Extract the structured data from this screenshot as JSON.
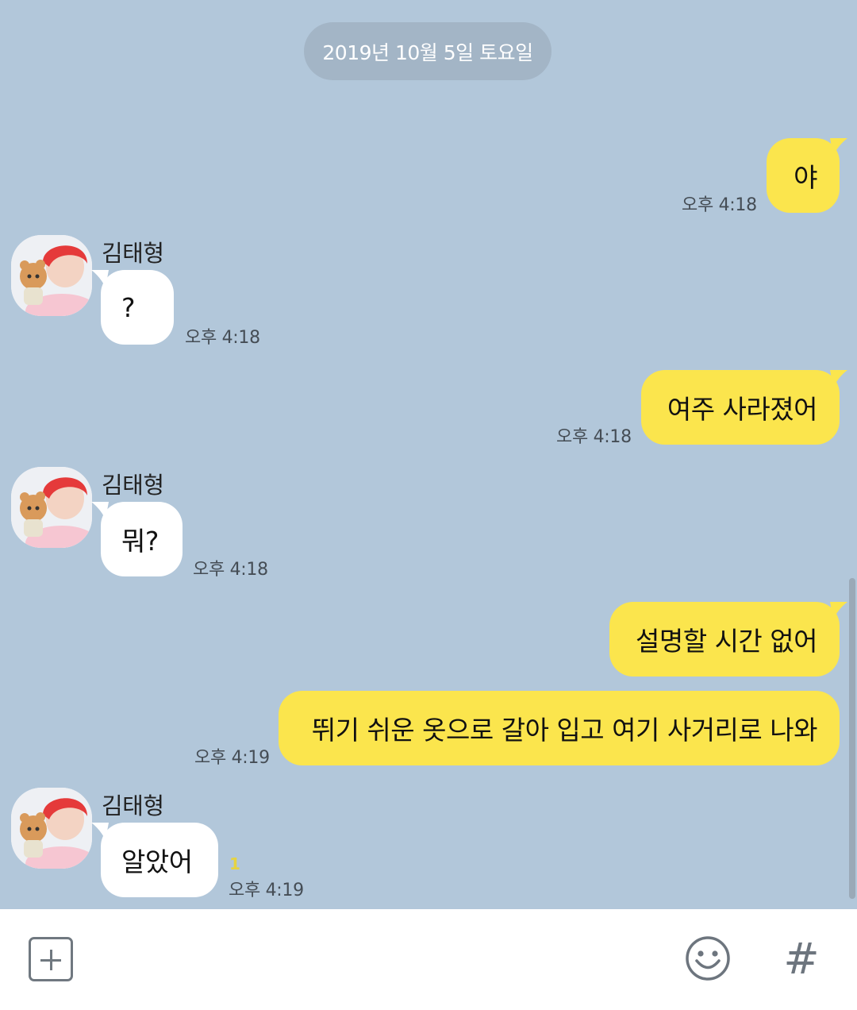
{
  "date_divider": "2019년 10월 5일 토요일",
  "contact": {
    "name": "김태형"
  },
  "messages": [
    {
      "from": "me",
      "text": "야",
      "time": "오후 4:18"
    },
    {
      "from": "other",
      "text": "?",
      "time": "오후 4:18"
    },
    {
      "from": "me",
      "text": "여주 사라졌어",
      "time": "오후 4:18"
    },
    {
      "from": "other",
      "text": "뭐?",
      "time": "오후 4:18"
    },
    {
      "from": "me",
      "text": "설명할 시간 없어",
      "time": ""
    },
    {
      "from": "me",
      "text": "뛰기 쉬운 옷으로 갈아 입고 여기 사거리로 나와",
      "time": "오후 4:19"
    },
    {
      "from": "other",
      "text": "알았어",
      "time": "오후 4:19",
      "unread": "1"
    }
  ],
  "input_bar": {
    "add_icon": "plus-square-icon",
    "emoji_icon": "smiley-icon",
    "hash_icon": "hash-icon",
    "hash_label": "#"
  },
  "colors": {
    "background": "#b2c7da",
    "my_bubble": "#fbe54d",
    "their_bubble": "#ffffff",
    "date_pill": "#a3b5c6"
  }
}
